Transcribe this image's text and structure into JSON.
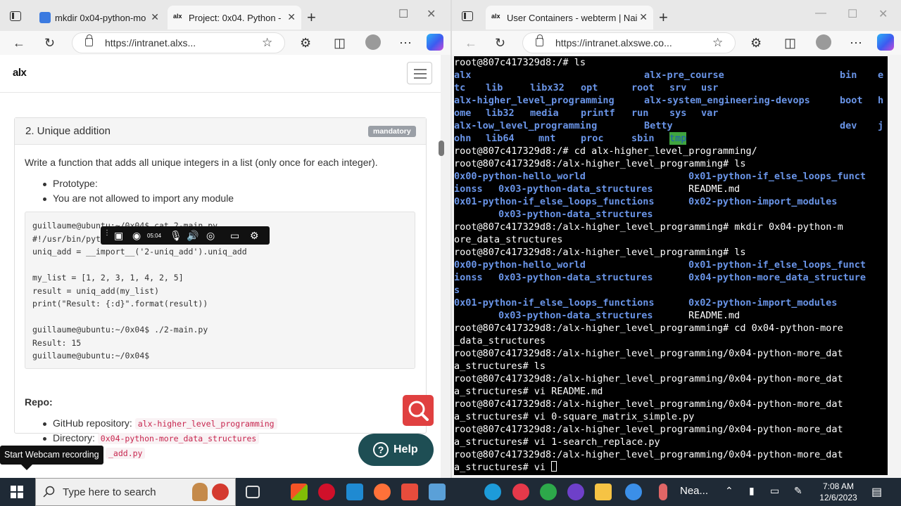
{
  "left_window": {
    "tabs": [
      {
        "label": "mkdir 0x04-python-mo",
        "active": false
      },
      {
        "label": "Project: 0x04. Python -",
        "active": true
      }
    ],
    "url": "https://intranet.alxs..."
  },
  "right_window": {
    "tabs": [
      {
        "label": "User Containers - webterm | Nai",
        "active": true
      }
    ],
    "url": "https://intranet.alxswe.co..."
  },
  "site": {
    "logo": "alx"
  },
  "task": {
    "title": "2. Unique addition",
    "badge": "mandatory",
    "description": "Write a function that adds all unique integers in a list (only once for each integer).",
    "bullets": [
      "Prototype:",
      "You are not allowed to import any module"
    ],
    "code_lines": [
      "guillaume@ubuntu:~/0x04$ cat 2-main.py",
      "#!/usr/bin/python3",
      "uniq_add = __import__('2-uniq_add').uniq_add",
      "",
      "my_list = [1, 2, 3, 1, 4, 2, 5]",
      "result = uniq_add(my_list)",
      "print(\"Result: {:d}\".format(result))",
      "",
      "guillaume@ubuntu:~/0x04$ ./2-main.py",
      "Result: 15",
      "guillaume@ubuntu:~/0x04$"
    ],
    "repo_title": "Repo:",
    "repo_github_label": "GitHub repository:",
    "repo_github_value": "alx-higher_level_programming",
    "repo_dir_label": "Directory:",
    "repo_dir_value": "0x04-python-more_data_structures",
    "repo_file_value": "_add.py"
  },
  "help_button": "Help",
  "recorder": {
    "time": "05:04",
    "tooltip": "Start Webcam recording"
  },
  "terminal": {
    "prompt_root": "root@807c417329d8:/#",
    "line_ls1": " ls",
    "ls1": {
      "r1": [
        "alx",
        "alx-pre_course",
        "bin",
        "e"
      ],
      "r2": [
        "tc",
        "lib",
        "libx32",
        "opt",
        "root",
        "srv",
        "usr"
      ],
      "r3": [
        "alx-higher_level_programming",
        "alx-system_engineering-devops",
        "boot",
        "h"
      ],
      "r4": [
        "ome",
        "lib32",
        "media",
        "printf",
        "run",
        "sys",
        "var"
      ],
      "r5": [
        "alx-low_level_programming",
        "Betty",
        "dev",
        "j"
      ],
      "r6": [
        "ohn",
        "lib64",
        "mnt",
        "proc",
        "sbin",
        "tmp"
      ]
    },
    "cmd_cd1": " cd alx-higher_level_programming/",
    "prompt_hlp": "root@807c417329d8:/alx-higher_level_programming#",
    "cmd_ls": " ls",
    "ls2": {
      "a": "0x00-python-hello_world",
      "b": "0x01-python-if_else_loops_funct",
      "c": "ionss",
      "d": "0x03-python-data_structures",
      "e": "README.md",
      "f": "0x01-python-if_else_loops_functions",
      "g": "0x02-python-import_modules",
      "h": "0x03-python-data_structures"
    },
    "cmd_mkdir": " mkdir 0x04-python-m",
    "mkdir_wrap": "ore_data_structures",
    "ls3": {
      "a": "0x00-python-hello_world",
      "b": "0x01-python-if_else_loops_funct",
      "c": "ionss",
      "d": "0x03-python-data_structures",
      "e": "0x04-python-more_data_structure",
      "f": "s",
      "g": "0x01-python-if_else_loops_functions",
      "h": "0x02-python-import_modules",
      "i": "0x03-python-data_structures",
      "j": "README.md"
    },
    "cmd_cd2": " cd 0x04-python-more",
    "cd2_wrap": "_data_structures",
    "prompt_04": "root@807c417329d8:/alx-higher_level_programming/0x04-python-more_dat",
    "prompt_04_wrap": "a_structures#",
    "cmds_04": [
      " ls",
      " vi README.md",
      " vi 0-square_matrix_simple.py",
      " vi 1-search_replace.py",
      " vi "
    ]
  },
  "taskbar": {
    "search_placeholder": "Type here to search",
    "weather": "Nea...",
    "time": "7:08 AM",
    "date": "12/6/2023"
  },
  "colors": {
    "terminal_dir": "#6a95e8",
    "help_bg": "#1e4e54",
    "search_fab": "#e04040",
    "badge": "#9a9fa6"
  }
}
